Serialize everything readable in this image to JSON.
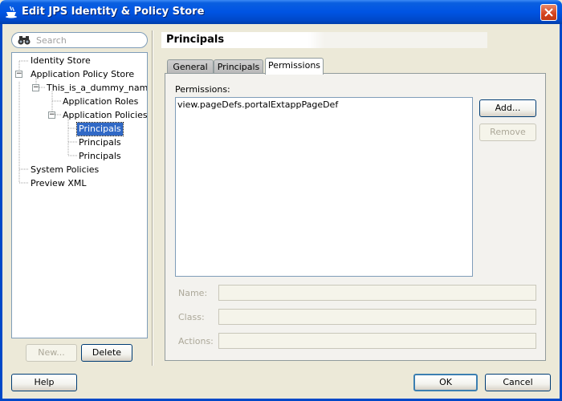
{
  "window": {
    "title": "Edit JPS Identity & Policy Store",
    "icon": "coffee-cup-icon"
  },
  "search": {
    "placeholder": "Search"
  },
  "tree": {
    "items": [
      {
        "label": "Identity Store",
        "level": 0
      },
      {
        "label": "Application Policy Store",
        "level": 0,
        "expanded": true
      },
      {
        "label": "This_is_a_dummy_name",
        "level": 1,
        "expanded": true
      },
      {
        "label": "Application Roles",
        "level": 2
      },
      {
        "label": "Application Policies",
        "level": 2,
        "expanded": true
      },
      {
        "label": "Principals",
        "level": 3,
        "selected": true
      },
      {
        "label": "Principals",
        "level": 3
      },
      {
        "label": "Principals",
        "level": 3
      },
      {
        "label": "System Policies",
        "level": 0
      },
      {
        "label": "Preview XML",
        "level": 0
      }
    ]
  },
  "tree_buttons": {
    "new_label": "New...",
    "delete_label": "Delete"
  },
  "panel": {
    "title": "Principals"
  },
  "tabs": [
    {
      "label": "General",
      "active": false
    },
    {
      "label": "Principals",
      "active": false
    },
    {
      "label": "Permissions",
      "active": true
    }
  ],
  "permissions": {
    "label": "Permissions:",
    "items": [
      "view.pageDefs.portalExtappPageDef"
    ],
    "add_label": "Add...",
    "remove_label": "Remove"
  },
  "fields": {
    "name_label": "Name:",
    "class_label": "Class:",
    "actions_label": "Actions:"
  },
  "footer": {
    "help_label": "Help",
    "ok_label": "OK",
    "cancel_label": "Cancel"
  },
  "colors": {
    "title_bar": "#0054e3",
    "selection": "#3169c6",
    "dialog_bg": "#ece9d8"
  }
}
